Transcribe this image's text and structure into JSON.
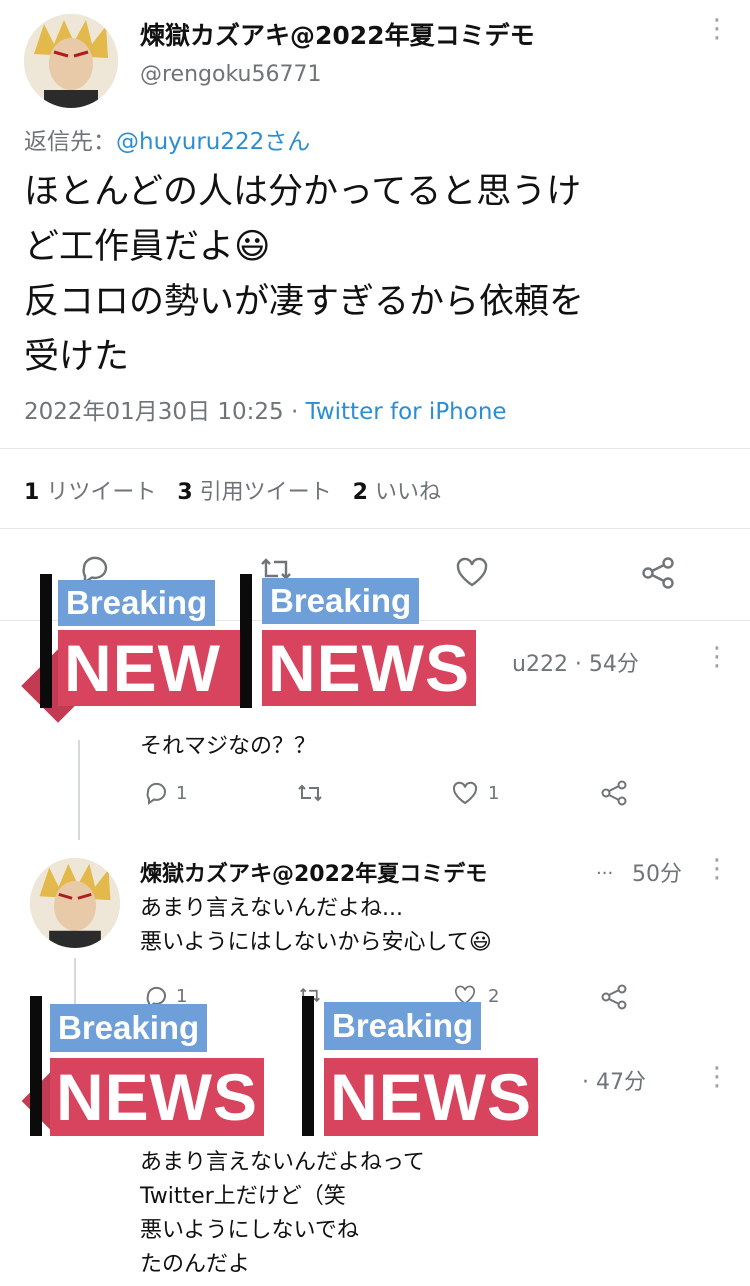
{
  "tweet": {
    "author_name": "煉獄カズアキ@2022年夏コミデモ",
    "author_handle": "@rengoku56771",
    "reply_prefix": "返信先：",
    "reply_to": "@huyuru222さん",
    "lines": [
      "ほとんどの人は分かってると思うけ",
      "ど工作員だよ",
      "反コロの勢いが凄すぎるから依頼を",
      "受けた"
    ],
    "emoji": "😃",
    "timestamp": "2022年01月30日 10:25 · ",
    "source": "Twitter for iPhone",
    "stats": {
      "retweets_count": "1",
      "retweets_label": "リツイート",
      "quotes_count": "3",
      "quotes_label": "引用ツイート",
      "likes_count": "2",
      "likes_label": "いいね"
    }
  },
  "overlays": {
    "breaking_label": "Breaking",
    "news_label": "NEWS",
    "news_label_cut": "NEW"
  },
  "replies": [
    {
      "handle_fragment": "u222 · 54分",
      "text": "それマジなの？？",
      "reply_count": "1",
      "like_count": "1"
    },
    {
      "author_name": "煉獄カズアキ@2022年夏コミデモ",
      "ellipsis": "...",
      "time": "50分",
      "lines": [
        "あまり言えないんだよね...",
        "悪いようにはしないから安心して"
      ],
      "emoji": "😃",
      "reply_count": "1",
      "like_count": "2"
    },
    {
      "time": "· 47分",
      "lines": [
        "あまり言えないんだよねって",
        "Twitter上だけど（笑",
        "悪いようにしないでね",
        "たのんだよ"
      ]
    }
  ],
  "colors": {
    "link": "#2b8ed4",
    "breaking_bg": "#6f9fd8",
    "news_bg": "#d8445e",
    "muted": "#6f7478"
  },
  "icons": [
    "kebab-icon",
    "reply-icon",
    "retweet-icon",
    "heart-icon",
    "share-icon"
  ]
}
